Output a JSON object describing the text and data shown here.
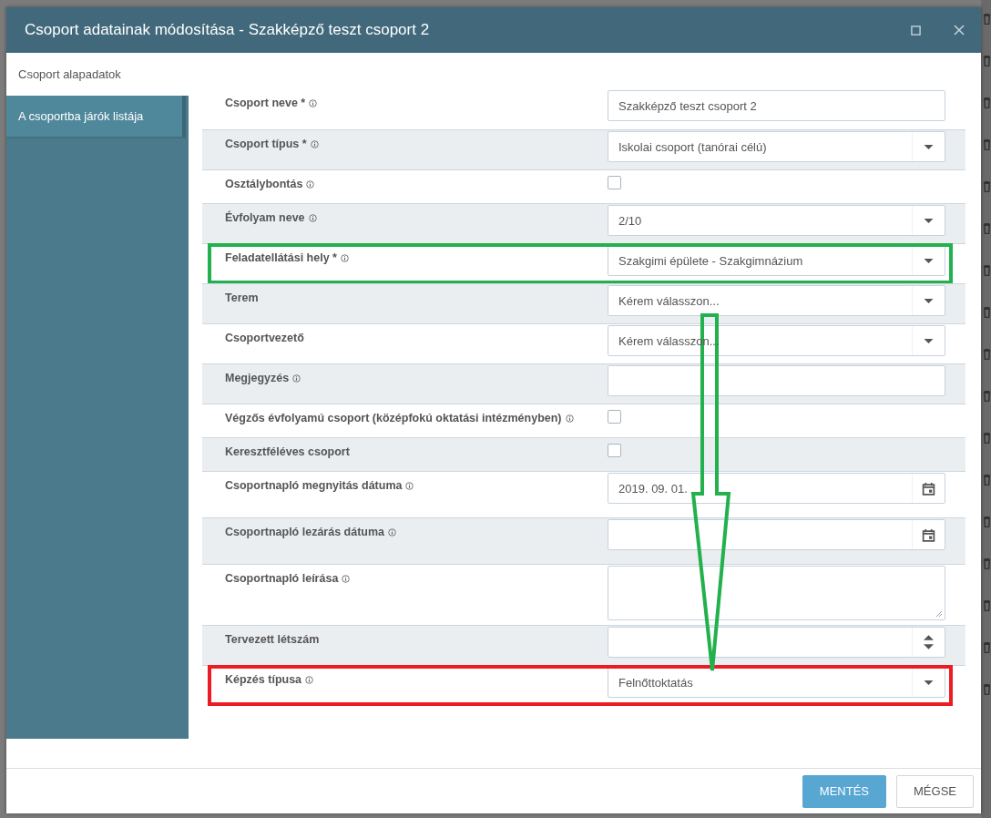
{
  "window": {
    "title": "Csoport adatainak módosítása - Szakképző teszt csoport 2"
  },
  "sidebar": {
    "items": [
      {
        "label": "Csoport alapadatok",
        "selected": true
      },
      {
        "label": "A csoportba járók listája",
        "selected": false
      }
    ]
  },
  "form": {
    "rows": [
      {
        "label": "Csoport neve *",
        "info": true,
        "kind": "text",
        "value": "Szakképző teszt csoport 2"
      },
      {
        "label": "Csoport típus *",
        "info": true,
        "kind": "select",
        "value": "Iskolai csoport (tanórai célú)"
      },
      {
        "label": "Osztálybontás",
        "info": true,
        "kind": "checkbox",
        "checked": false
      },
      {
        "label": "Évfolyam neve",
        "info": true,
        "kind": "select",
        "value": "2/10"
      },
      {
        "label": "Feladatellátási hely *",
        "info": true,
        "kind": "select",
        "value": "Szakgimi épülete - Szakgimnázium",
        "color": "#22b14c"
      },
      {
        "label": "Terem",
        "info": false,
        "kind": "select",
        "placeholder": "Kérem válasszon..."
      },
      {
        "label": "Csoportvezető",
        "info": false,
        "kind": "select",
        "placeholder": "Kérem válasszon..."
      },
      {
        "label": "Megjegyzés",
        "info": true,
        "kind": "text"
      },
      {
        "label": "Végzős évfolyamú csoport (középfokú oktatási intézményben)",
        "info": true,
        "kind": "checkbox",
        "checked": false
      },
      {
        "label": "Keresztféléves csoport",
        "info": false,
        "kind": "checkbox",
        "checked": false
      },
      {
        "label": "Csoportnapló megnyitás dátuma",
        "info": true,
        "kind": "date",
        "value": "2019. 09. 01."
      },
      {
        "label": "Csoportnapló lezárás dátuma",
        "info": true,
        "kind": "date"
      },
      {
        "label": "Csoportnapló leírása",
        "info": true,
        "kind": "textarea"
      },
      {
        "label": "Tervezett létszám",
        "info": false,
        "kind": "number"
      },
      {
        "label": "Képzés típusa",
        "info": true,
        "kind": "select",
        "value": "Felnőttoktatás",
        "color": "#ed1c24"
      }
    ]
  },
  "annotation_arrow": {
    "color": "#22b14c"
  },
  "buttons": [
    {
      "label": "MENTÉS",
      "kind": "primary"
    },
    {
      "label": "MÉGSE",
      "kind": "secondary"
    }
  ]
}
